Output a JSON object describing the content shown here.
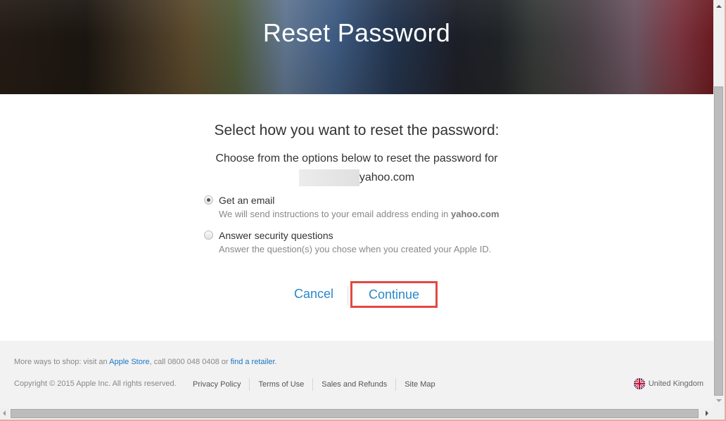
{
  "hero": {
    "title": "Reset Password"
  },
  "main": {
    "subtitle": "Select how you want to reset the password:",
    "description": "Choose from the options below to reset the password for",
    "email_suffix": "yahoo.com",
    "options": [
      {
        "label": "Get an email",
        "help_prefix": "We will send instructions to your email address ending in ",
        "help_bold": "yahoo.com",
        "checked": true
      },
      {
        "label": "Answer security questions",
        "help_prefix": "Answer the question(s) you chose when you created your Apple ID.",
        "help_bold": "",
        "checked": false
      }
    ],
    "cancel_label": "Cancel",
    "continue_label": "Continue"
  },
  "footer": {
    "shop_prefix": "More ways to shop: visit an ",
    "apple_store_link": "Apple Store",
    "shop_middle": ", call 0800 048 0408 or ",
    "find_retailer_link": "find a retailer",
    "shop_suffix": ".",
    "copyright": "Copyright © 2015 Apple Inc. All rights reserved.",
    "links": [
      "Privacy Policy",
      "Terms of Use",
      "Sales and Refunds",
      "Site Map"
    ],
    "region": "United Kingdom",
    "region_icon": "uk-flag-icon"
  },
  "colors": {
    "link_blue": "#2a87c9",
    "highlight_red": "#e04a43",
    "footer_bg": "#f2f2f2"
  }
}
